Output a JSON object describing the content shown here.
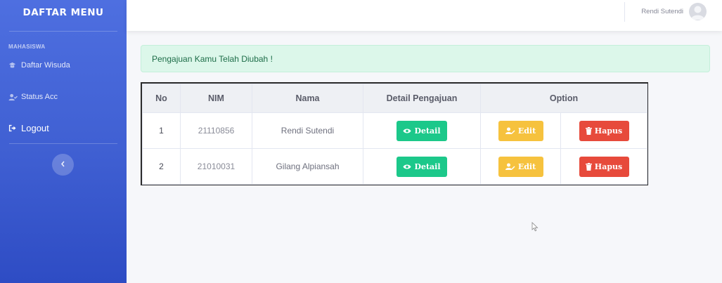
{
  "sidebar": {
    "brand": "DAFTAR MENU",
    "heading": "MAHASISWA",
    "items": [
      {
        "label": "Daftar Wisuda",
        "icon": "graduation-icon"
      },
      {
        "label": "Status Acc",
        "icon": "user-check-icon"
      },
      {
        "label": "Logout",
        "icon": "sign-out-icon"
      }
    ],
    "toggle_icon": "chevron-left-icon"
  },
  "topbar": {
    "username": "Rendi Sutendi",
    "avatar_icon": "user-avatar-icon"
  },
  "alert": {
    "message": "Pengajuan Kamu Telah Diubah !"
  },
  "table": {
    "headers": {
      "no": "No",
      "nim": "NIM",
      "nama": "Nama",
      "detail": "Detail Pengajuan",
      "option": "Option"
    },
    "rows": [
      {
        "no": "1",
        "nim": "21110856",
        "nama": "Rendi Sutendi"
      },
      {
        "no": "2",
        "nim": "21010031",
        "nama": "Gilang Alpiansah"
      }
    ],
    "buttons": {
      "detail": "Detail",
      "edit": "Edit",
      "hapus": "Hapus"
    }
  },
  "colors": {
    "sidebar": "#4e6fe0",
    "detail": "#1cc88a",
    "edit": "#f6c23e",
    "hapus": "#e74a3b",
    "alert_bg": "#dcf7ea"
  }
}
